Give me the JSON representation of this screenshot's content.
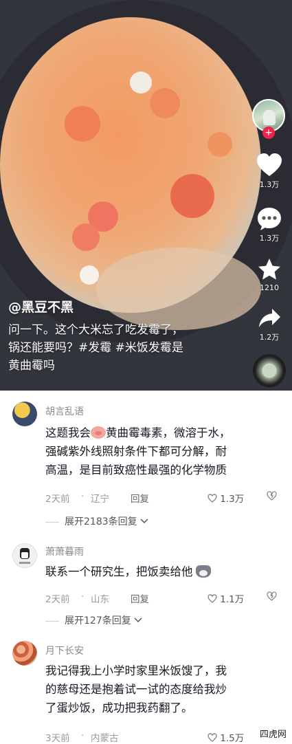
{
  "video": {
    "author": "@黑豆不黑",
    "description_lines": [
      "问一下。这个大米忘了吃发霉了，",
      "锅还能要吗？#发霉 #米饭发霉是",
      "黄曲霉吗"
    ],
    "actions": {
      "likes": "1.3万",
      "comments": "1.3万",
      "favorites": "1210",
      "shares": "1.2万"
    }
  },
  "comments": [
    {
      "name": "胡言乱语",
      "text_lines": [
        "这题我会",
        "黄曲霉毒素，微溶于水，",
        "强碱紫外线照射条件下都可分解，耐",
        "高温，是目前致癌性最强的化学物质"
      ],
      "time": "2天前",
      "location": "辽宁",
      "reply": "回复",
      "likes": "1.3万",
      "expand": "展开2183条回复"
    },
    {
      "name": "萧萧暮雨",
      "text_lines": [
        "联系一个研究生，把饭卖给他"
      ],
      "time": "2天前",
      "location": "山东",
      "reply": "回复",
      "likes": "1.1万",
      "expand": "展开127条回复"
    },
    {
      "name": "月下长安",
      "text_lines": [
        "我记得我上小学时家里米饭馊了，我",
        "的慈母还是抱着试一试的态度给我炒",
        "了蛋炒饭，成功把我药翻了。"
      ],
      "time": "3天前",
      "location": "内蒙古",
      "likes": "1.5万"
    }
  ],
  "watermark": "四虎网",
  "icons": [
    "follow-plus-icon",
    "heart-icon",
    "comment-bubble-icon",
    "star-icon",
    "share-arrow-icon",
    "music-disc-icon",
    "like-heart-outline-icon",
    "dislike-heart-icon",
    "chevron-down-icon",
    "pig-emoji-icon",
    "husky-emoji-icon"
  ]
}
